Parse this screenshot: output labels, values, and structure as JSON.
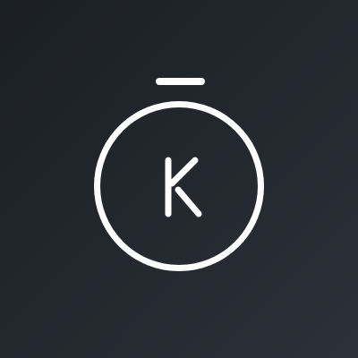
{
  "logo": {
    "monogram": "K",
    "stroke_color": "#ffffff",
    "icon": "stopwatch-icon"
  },
  "background": {
    "color_start": "#1b1f24",
    "color_end": "#2c3139"
  }
}
